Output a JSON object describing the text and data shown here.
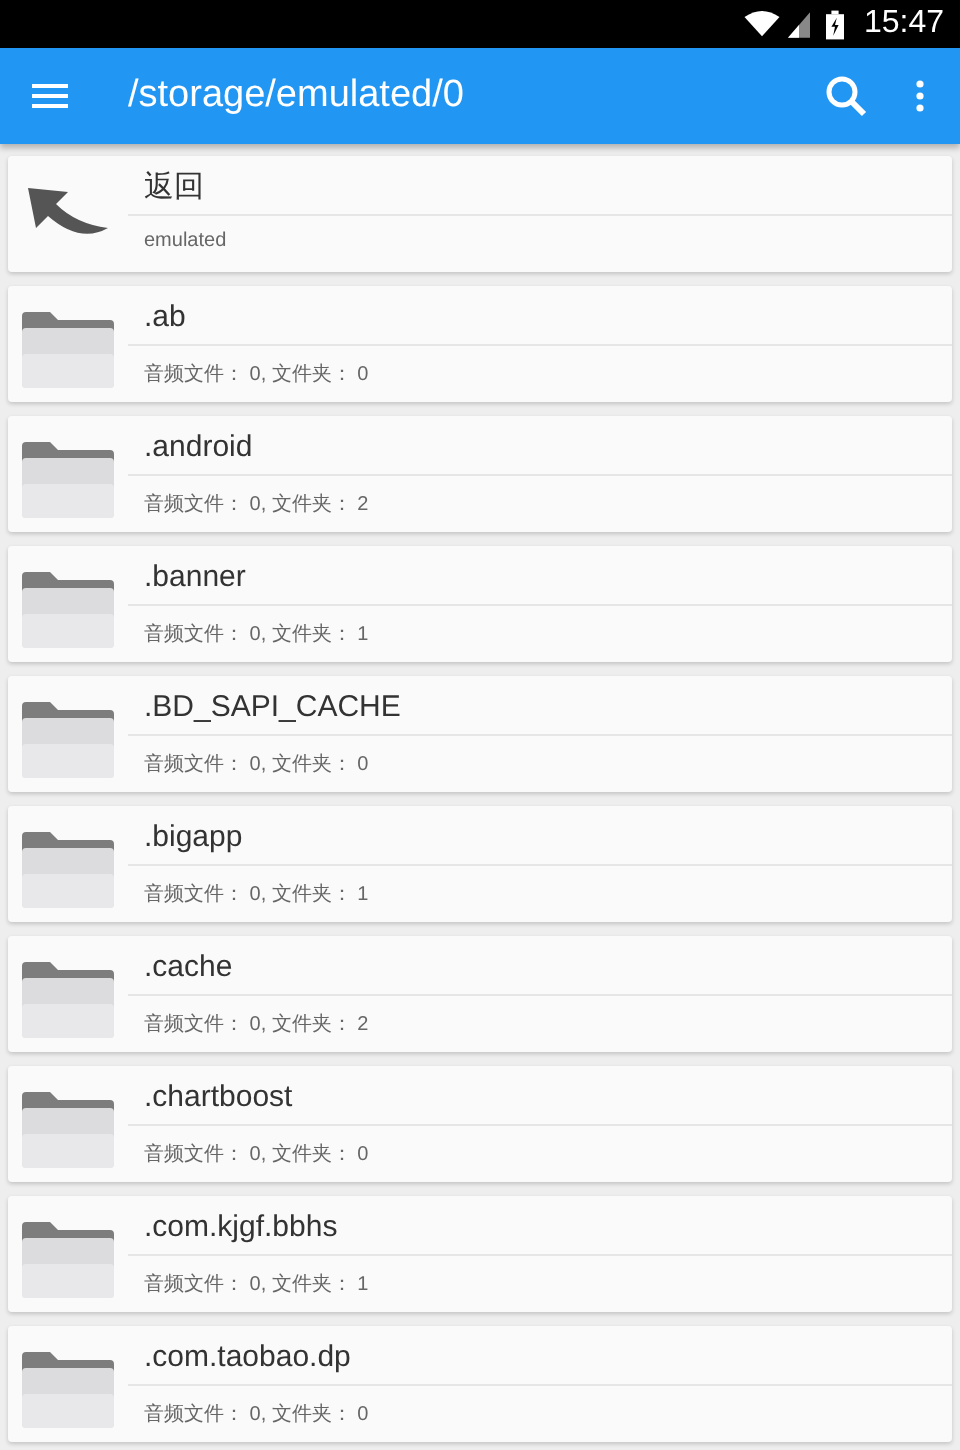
{
  "status_bar": {
    "time": "15:47"
  },
  "toolbar": {
    "title": "/storage/emulated/0"
  },
  "items": [
    {
      "kind": "back",
      "name": "返回",
      "detail": "emulated"
    },
    {
      "kind": "folder",
      "name": ".ab",
      "detail": "音频文件： 0, 文件夹： 0"
    },
    {
      "kind": "folder",
      "name": ".android",
      "detail": "音频文件： 0, 文件夹： 2"
    },
    {
      "kind": "folder",
      "name": ".banner",
      "detail": "音频文件： 0, 文件夹： 1"
    },
    {
      "kind": "folder",
      "name": ".BD_SAPI_CACHE",
      "detail": "音频文件： 0, 文件夹： 0"
    },
    {
      "kind": "folder",
      "name": ".bigapp",
      "detail": "音频文件： 0, 文件夹： 1"
    },
    {
      "kind": "folder",
      "name": ".cache",
      "detail": "音频文件： 0, 文件夹： 2"
    },
    {
      "kind": "folder",
      "name": ".chartboost",
      "detail": "音频文件： 0, 文件夹： 0"
    },
    {
      "kind": "folder",
      "name": ".com.kjgf.bbhs",
      "detail": "音频文件： 0, 文件夹： 1"
    },
    {
      "kind": "folder",
      "name": ".com.taobao.dp",
      "detail": "音频文件： 0, 文件夹： 0"
    }
  ]
}
